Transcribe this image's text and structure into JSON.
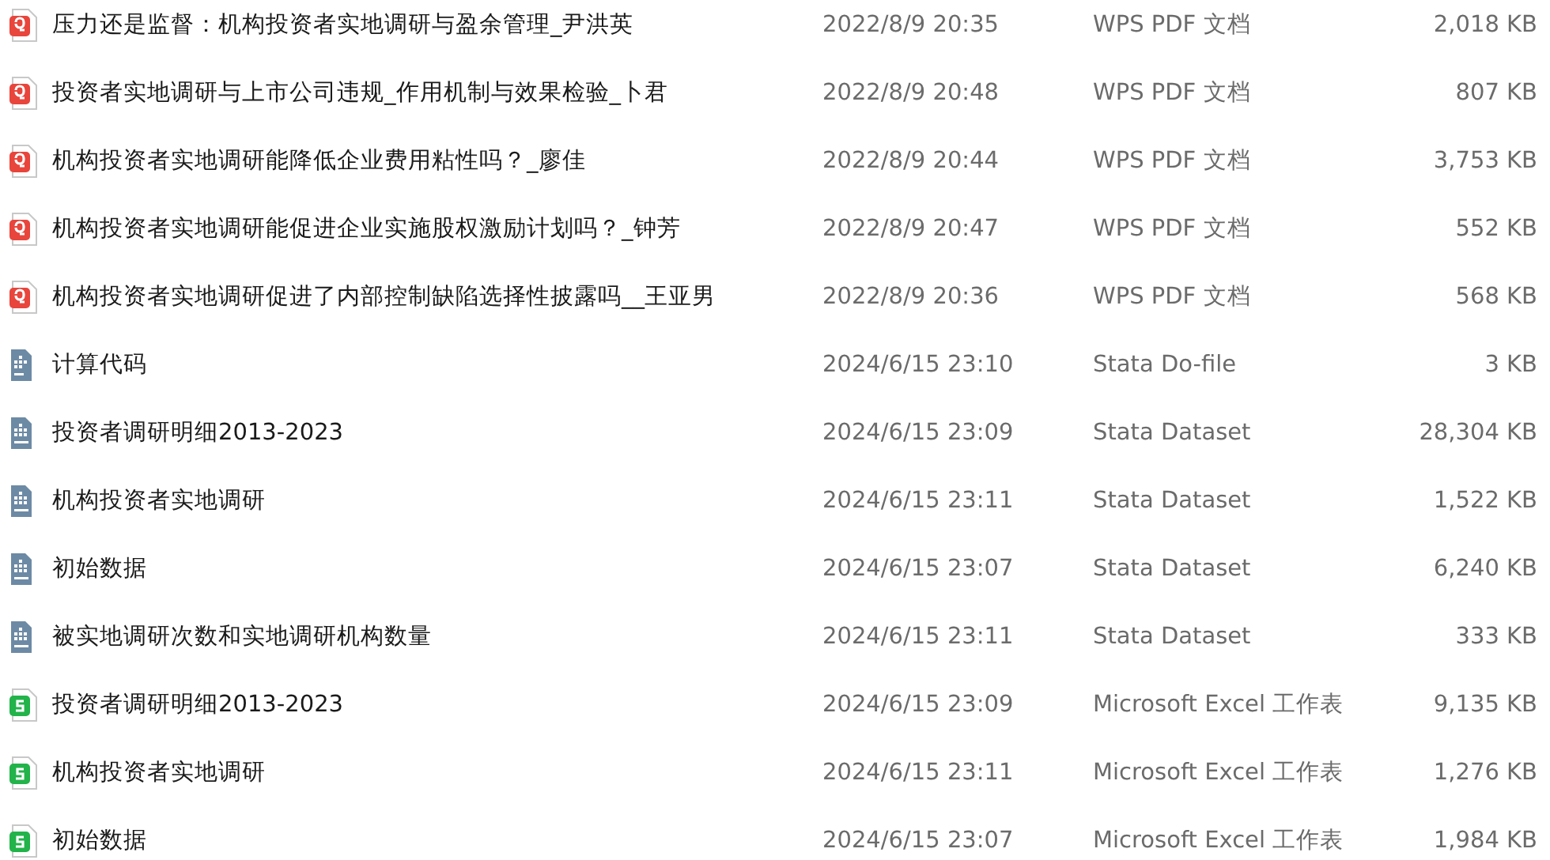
{
  "files": [
    {
      "kind": "pdf",
      "name": "压力还是监督：机构投资者实地调研与盈余管理_尹洪英",
      "modified": "2022/8/9 20:35",
      "type": "WPS PDF 文档",
      "size": "2,018 KB"
    },
    {
      "kind": "pdf",
      "name": "投资者实地调研与上市公司违规_作用机制与效果检验_卜君",
      "modified": "2022/8/9 20:48",
      "type": "WPS PDF 文档",
      "size": "807 KB"
    },
    {
      "kind": "pdf",
      "name": "机构投资者实地调研能降低企业费用粘性吗？_廖佳",
      "modified": "2022/8/9 20:44",
      "type": "WPS PDF 文档",
      "size": "3,753 KB"
    },
    {
      "kind": "pdf",
      "name": "机构投资者实地调研能促进企业实施股权激励计划吗？_钟芳",
      "modified": "2022/8/9 20:47",
      "type": "WPS PDF 文档",
      "size": "552 KB"
    },
    {
      "kind": "pdf",
      "name": "机构投资者实地调研促进了内部控制缺陷选择性披露吗__王亚男",
      "modified": "2022/8/9 20:36",
      "type": "WPS PDF 文档",
      "size": "568 KB"
    },
    {
      "kind": "do",
      "name": "计算代码",
      "modified": "2024/6/15 23:10",
      "type": "Stata Do-file",
      "size": "3 KB"
    },
    {
      "kind": "dta",
      "name": "投资者调研明细2013-2023",
      "modified": "2024/6/15 23:09",
      "type": "Stata Dataset",
      "size": "28,304 KB"
    },
    {
      "kind": "dta",
      "name": "机构投资者实地调研",
      "modified": "2024/6/15 23:11",
      "type": "Stata Dataset",
      "size": "1,522 KB"
    },
    {
      "kind": "dta",
      "name": "初始数据",
      "modified": "2024/6/15 23:07",
      "type": "Stata Dataset",
      "size": "6,240 KB"
    },
    {
      "kind": "dta",
      "name": "被实地调研次数和实地调研机构数量",
      "modified": "2024/6/15 23:11",
      "type": "Stata Dataset",
      "size": "333 KB"
    },
    {
      "kind": "excel",
      "name": "投资者调研明细2013-2023",
      "modified": "2024/6/15 23:09",
      "type": "Microsoft Excel 工作表",
      "size": "9,135 KB"
    },
    {
      "kind": "excel",
      "name": "机构投资者实地调研",
      "modified": "2024/6/15 23:11",
      "type": "Microsoft Excel 工作表",
      "size": "1,276 KB"
    },
    {
      "kind": "excel",
      "name": "初始数据",
      "modified": "2024/6/15 23:07",
      "type": "Microsoft Excel 工作表",
      "size": "1,984 KB"
    }
  ]
}
